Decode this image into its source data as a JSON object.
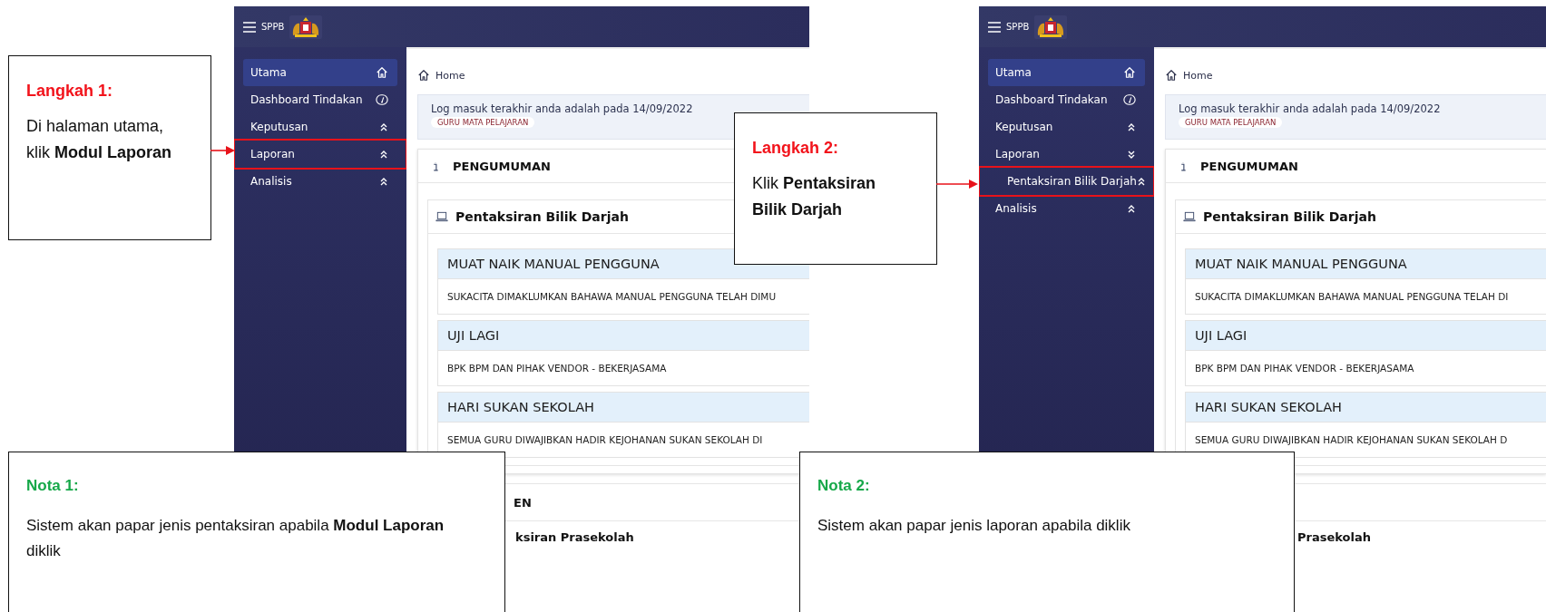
{
  "screenshots": [
    {
      "header": {
        "app_name": "SPPB"
      },
      "sidebar": {
        "items": [
          {
            "label": "Utama",
            "kind": "home",
            "selected": true,
            "highlighted": false
          },
          {
            "label": "Dashboard Tindakan",
            "kind": "dashboard",
            "selected": false,
            "highlighted": false
          },
          {
            "label": "Keputusan",
            "kind": "group",
            "selected": false,
            "highlighted": false,
            "expanded": false
          },
          {
            "label": "Laporan",
            "kind": "group",
            "selected": false,
            "highlighted": true,
            "expanded": false
          },
          {
            "label": "Analisis",
            "kind": "group",
            "selected": false,
            "highlighted": false,
            "expanded": false
          }
        ]
      },
      "breadcrumb": "Home",
      "login": {
        "message": "Log masuk terakhir anda adalah pada 14/09/2022",
        "role": "GURU MATA PELAJARAN"
      },
      "announcement": {
        "title": "PENGUMUMAN",
        "section_title": "Pentaksiran Bilik Darjah",
        "items": [
          {
            "title": "MUAT NAIK MANUAL PENGGUNA",
            "body": "SUKACITA DIMAKLUMKAN BAHAWA MANUAL PENGGUNA TELAH DIMU"
          },
          {
            "title": "UJI LAGI",
            "body": "BPK BPM DAN PIHAK VENDOR - BEKERJASAMA"
          },
          {
            "title": "HARI SUKAN SEKOLAH",
            "body": "SEMUA GURU DIWAJIBKAN HADIR KEJOHANAN SUKAN SEKOLAH DI"
          }
        ]
      },
      "next_section": {
        "title": "EN",
        "subtitle": "ksiran Prasekolah"
      }
    },
    {
      "header": {
        "app_name": "SPPB"
      },
      "sidebar": {
        "items": [
          {
            "label": "Utama",
            "kind": "home",
            "selected": true,
            "highlighted": false
          },
          {
            "label": "Dashboard Tindakan",
            "kind": "dashboard",
            "selected": false,
            "highlighted": false
          },
          {
            "label": "Keputusan",
            "kind": "group",
            "selected": false,
            "highlighted": false,
            "expanded": false
          },
          {
            "label": "Laporan",
            "kind": "group",
            "selected": false,
            "highlighted": false,
            "expanded": true,
            "children": [
              {
                "label": "Pentaksiran Bilik Darjah",
                "kind": "group",
                "selected": false,
                "highlighted": true,
                "expanded": false
              }
            ]
          },
          {
            "label": "Analisis",
            "kind": "group",
            "selected": false,
            "highlighted": false,
            "expanded": false
          }
        ]
      },
      "breadcrumb": "Home",
      "login": {
        "message": "Log masuk terakhir anda adalah pada 14/09/2022",
        "role": "GURU MATA PELAJARAN"
      },
      "announcement": {
        "title": "PENGUMUMAN",
        "section_title": "Pentaksiran Bilik Darjah",
        "items": [
          {
            "title": "MUAT NAIK MANUAL PENGGUNA",
            "body": "SUKACITA DIMAKLUMKAN BAHAWA MANUAL PENGGUNA TELAH DI"
          },
          {
            "title": "UJI LAGI",
            "body": "BPK BPM DAN PIHAK VENDOR - BEKERJASAMA"
          },
          {
            "title": "HARI SUKAN SEKOLAH",
            "body": "SEMUA GURU DIWAJIBKAN HADIR KEJOHANAN SUKAN SEKOLAH D"
          }
        ]
      },
      "next_section": {
        "subtitle": "Prasekolah"
      }
    }
  ],
  "steps": [
    {
      "heading": "Langkah 1:",
      "text": "Di halaman utama, klik **Modul Laporan**"
    },
    {
      "heading": "Langkah 2:",
      "text": "Klik **Pentaksiran Bilik Darjah**"
    }
  ],
  "notes": [
    {
      "heading": "Nota 1:",
      "text": "Sistem akan papar jenis pentaksiran apabila **Modul Laporan** diklik"
    },
    {
      "heading": "Nota 2:",
      "text": "Sistem akan papar jenis laporan apabila diklik"
    }
  ]
}
